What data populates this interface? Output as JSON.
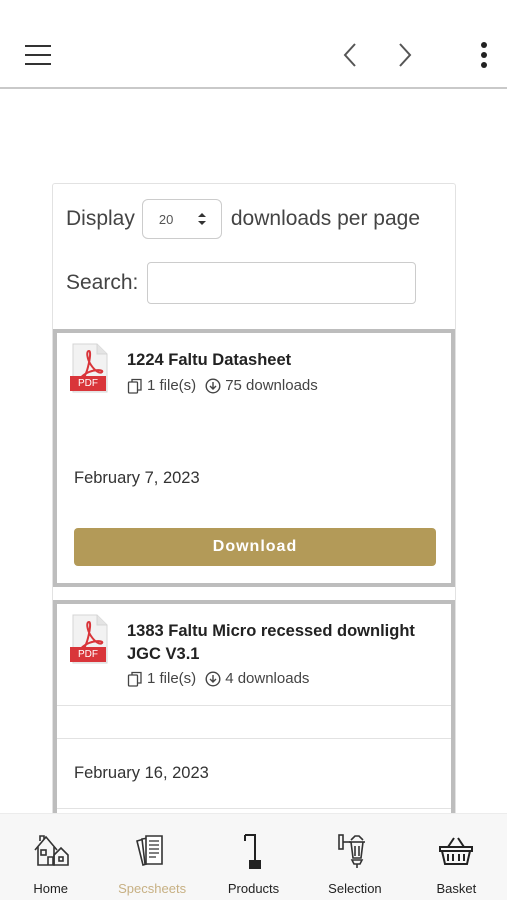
{
  "topbar": {
    "menu_icon": "hamburger-icon",
    "prev_icon": "chevron-left-icon",
    "next_icon": "chevron-right-icon",
    "more_icon": "kebab-menu-icon"
  },
  "controls": {
    "display_label": "Display",
    "per_page_value": "20",
    "per_page_suffix": "downloads per page",
    "search_label": "Search:",
    "search_value": ""
  },
  "downloads": [
    {
      "title": "1224 Faltu Datasheet",
      "files": "1 file(s)",
      "downloads": "75 downloads",
      "date": "February 7, 2023",
      "button_label": "Download",
      "icon": "pdf-icon"
    },
    {
      "title": "1383 Faltu Micro recessed downlight JGC V3.1",
      "files": "1 file(s)",
      "downloads": "4 downloads",
      "date": "February 16, 2023",
      "icon": "pdf-icon"
    }
  ],
  "pdf_badge": "PDF",
  "bottom_nav": [
    {
      "label": "Home",
      "icon": "home-icon",
      "active": false
    },
    {
      "label": "Specsheets",
      "icon": "specsheets-icon",
      "active": true
    },
    {
      "label": "Products",
      "icon": "lamp-icon",
      "active": false
    },
    {
      "label": "Selection",
      "icon": "wall-lantern-icon",
      "active": false
    },
    {
      "label": "Basket",
      "icon": "basket-icon",
      "active": false
    }
  ],
  "colors": {
    "accent": "#b39a58",
    "active_nav": "#c7b083",
    "pdf_red": "#d9353a"
  }
}
